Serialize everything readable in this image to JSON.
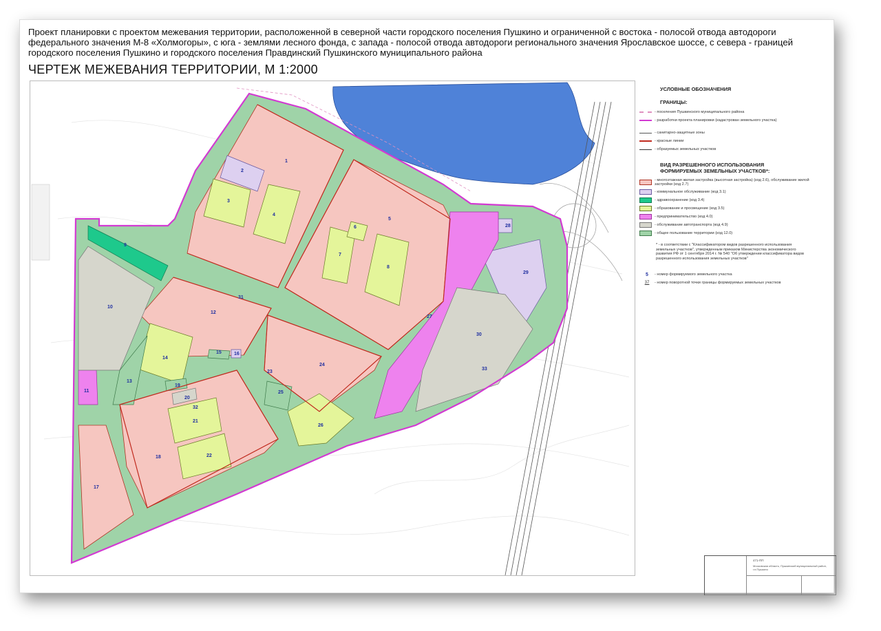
{
  "title": "Проект планировки с проектом межевания территории, расположенной в северной части городского поселения Пушкино и ограниченной с востока -  полосой отвода автодороги федерального значения М-8 «Холмогоры», с юга - землями лесного фонда, с запада - полосой отвода автодороги регионального значения Ярославское шоссе, с севера - границей городского поселения Пушкино и городского поселения Правдинский Пушкинского муниципального района",
  "heading": "ЧЕРТЕЖ МЕЖЕВАНИЯ ТЕРРИТОРИИ,  М 1:2000",
  "colors": {
    "residential": "#f6c6c0",
    "communal": "#ddd0f0",
    "health": "#1ec98c",
    "education": "#e4f59a",
    "business": "#ee82ee",
    "transport": "#d6d6cc",
    "public": "#9fd3a8",
    "boundary": "#d23ad2",
    "red_line": "#c02a1e",
    "water": "#4f82d8"
  },
  "legend": {
    "title": "УСЛОВНЫЕ ОБОЗНАЧЕНИЯ",
    "borders_title": "ГРАНИЦЫ:",
    "borders": [
      "- поселения Пушкинского муниципального района",
      "- разработки проекта планировки (кадастрован земельного участка)",
      "- санитарно-защитные зоны",
      "- красные линии",
      "- образуемых земельных участков"
    ],
    "use_title": "ВИД РАЗРЕШЕННОГО ИСПОЛЬЗОВАНИЯ",
    "use_title2": "ФОРМИРУЕМЫХ ЗЕМЕЛЬНЫХ УЧАСТКОВ*:",
    "uses": [
      "- многоэтажная жилая застройка (высотная застройка) (код 2.6), обслуживание жилой застройки (код 2.7)",
      "- коммунальное обслуживание (код 3.1)",
      "- здравоохранение (код 3.4)",
      "- образование и просвещение (код 3.5)",
      "- предпринимательство (код 4.0)",
      "- обслуживание автотранспорта (код 4.9)",
      "- общее пользование территории (код 12.0)"
    ],
    "footnote": "* - в соответствии с \"Классификатором видов разрешенного использования земельных участков\", утвержденным приказом Министерства экономического развития РФ от 1 сентября 2014 г. № 540 \"Об утверждении классификатора видов разрешенного использования земельных участков\"",
    "parcel_number_sample": "5",
    "parcel_number_text": "- номер формируемого земельного участка",
    "point_number_sample": "37",
    "point_number_text": "- номер поворотной точки границы формируемых земельных участков"
  },
  "parcels": [
    "1",
    "2",
    "3",
    "4",
    "5",
    "6",
    "7",
    "8",
    "9",
    "10",
    "11",
    "12",
    "13",
    "14",
    "15",
    "16",
    "17",
    "18",
    "19",
    "20",
    "21",
    "22",
    "23",
    "24",
    "25",
    "26",
    "27",
    "28",
    "29",
    "30",
    "31",
    "32",
    "33"
  ],
  "stamp": {
    "code": "471-ПП",
    "org": "Московская область, Пушкинский муниципальный район, г.п.Пушкино"
  }
}
